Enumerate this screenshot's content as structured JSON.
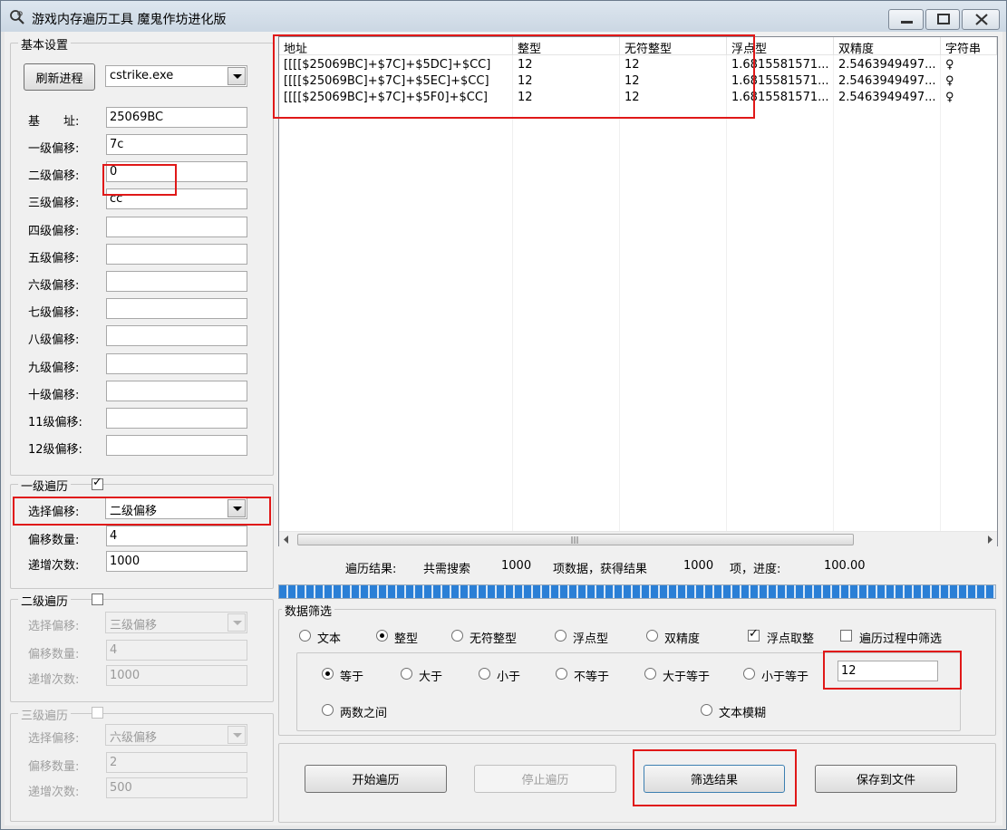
{
  "window": {
    "title": "游戏内存遍历工具 魔鬼作坊进化版"
  },
  "basic": {
    "legend": "基本设置",
    "refresh_btn": "刷新进程",
    "process": "cstrike.exe",
    "base_label": "基　　址:",
    "base_value": "25069BC",
    "offsets": [
      {
        "label": "一级偏移:",
        "value": "7c"
      },
      {
        "label": "二级偏移:",
        "value": "0"
      },
      {
        "label": "三级偏移:",
        "value": "cc"
      },
      {
        "label": "四级偏移:",
        "value": ""
      },
      {
        "label": "五级偏移:",
        "value": ""
      },
      {
        "label": "六级偏移:",
        "value": ""
      },
      {
        "label": "七级偏移:",
        "value": ""
      },
      {
        "label": "八级偏移:",
        "value": ""
      },
      {
        "label": "九级偏移:",
        "value": ""
      },
      {
        "label": "十级偏移:",
        "value": ""
      },
      {
        "label": "11级偏移:",
        "value": ""
      },
      {
        "label": "12级偏移:",
        "value": ""
      }
    ]
  },
  "trav1": {
    "legend": "一级遍历",
    "checked": true,
    "sel_label": "选择偏移:",
    "sel_value": "二级偏移",
    "count_label": "偏移数量:",
    "count_value": "4",
    "inc_label": "递增次数:",
    "inc_value": "1000"
  },
  "trav2": {
    "legend": "二级遍历",
    "checked": false,
    "sel_label": "选择偏移:",
    "sel_value": "三级偏移",
    "count_label": "偏移数量:",
    "count_value": "4",
    "inc_label": "递增次数:",
    "inc_value": "1000"
  },
  "trav3": {
    "legend": "三级遍历",
    "checked": false,
    "sel_label": "选择偏移:",
    "sel_value": "六级偏移",
    "count_label": "偏移数量:",
    "count_value": "2",
    "inc_label": "递增次数:",
    "inc_value": "500"
  },
  "list": {
    "columns": [
      "地址",
      "整型",
      "无符整型",
      "浮点型",
      "双精度",
      "字符串"
    ],
    "rows": [
      [
        "[[[[$25069BC]+$7C]+$5DC]+$CC]",
        "12",
        "12",
        "1.6815581571...",
        "2.5463949497...",
        "♀"
      ],
      [
        "[[[[$25069BC]+$7C]+$5EC]+$CC]",
        "12",
        "12",
        "1.6815581571...",
        "2.5463949497...",
        "♀"
      ],
      [
        "[[[[$25069BC]+$7C]+$5F0]+$CC]",
        "12",
        "12",
        "1.6815581571...",
        "2.5463949497...",
        "♀"
      ]
    ]
  },
  "status": {
    "label": "遍历结果:",
    "total_label": "共需搜索",
    "total": "1000",
    "mid_label": "项数据，获得结果",
    "found": "1000",
    "progress_label": "项，进度:",
    "progress": "100.00",
    "progress_fraction": 1.0
  },
  "filter": {
    "legend": "数据筛选",
    "types": [
      {
        "label": "文本",
        "checked": false
      },
      {
        "label": "整型",
        "checked": true
      },
      {
        "label": "无符整型",
        "checked": false
      },
      {
        "label": "浮点型",
        "checked": false
      },
      {
        "label": "双精度",
        "checked": false
      }
    ],
    "float_round": {
      "label": "浮点取整",
      "checked": true
    },
    "filter_during": {
      "label": "遍历过程中筛选",
      "checked": false
    },
    "conds": [
      {
        "label": "等于",
        "checked": true
      },
      {
        "label": "大于",
        "checked": false
      },
      {
        "label": "小于",
        "checked": false
      },
      {
        "label": "不等于",
        "checked": false
      },
      {
        "label": "大于等于",
        "checked": false
      },
      {
        "label": "小于等于",
        "checked": false
      }
    ],
    "value": "12",
    "between": {
      "label": "两数之间",
      "checked": false
    },
    "fuzzy": {
      "label": "文本模糊",
      "checked": false
    }
  },
  "actions": {
    "start": "开始遍历",
    "stop": "停止遍历",
    "filter": "筛选结果",
    "save": "保存到文件"
  }
}
